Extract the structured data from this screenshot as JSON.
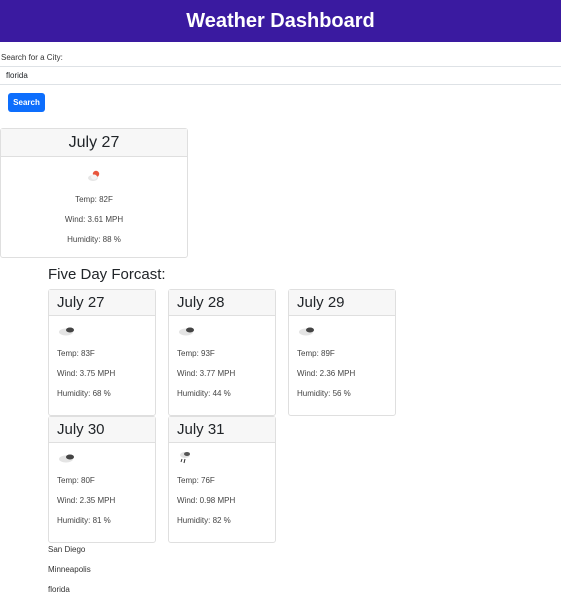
{
  "header": {
    "title": "Weather Dashboard"
  },
  "search": {
    "label": "Search for a City:",
    "value": "florida",
    "button_label": "Search"
  },
  "current": {
    "date": "July 27",
    "icon": "partly-cloudy-day-icon",
    "temp": "Temp: 82F",
    "wind": "Wind: 3.61 MPH",
    "humidity": "Humidity: 88 %"
  },
  "forecast": {
    "title": "Five Day Forcast:",
    "days": [
      {
        "date": "July 27",
        "icon": "overcast-clouds-icon",
        "temp": "Temp: 83F",
        "wind": "Wind: 3.75 MPH",
        "humidity": "Humidity: 68 %"
      },
      {
        "date": "July 28",
        "icon": "overcast-clouds-icon",
        "temp": "Temp: 93F",
        "wind": "Wind: 3.77 MPH",
        "humidity": "Humidity: 44 %"
      },
      {
        "date": "July 29",
        "icon": "overcast-clouds-icon",
        "temp": "Temp: 89F",
        "wind": "Wind: 2.36 MPH",
        "humidity": "Humidity: 56 %"
      },
      {
        "date": "July 30",
        "icon": "overcast-clouds-icon",
        "temp": "Temp: 80F",
        "wind": "Wind: 2.35 MPH",
        "humidity": "Humidity: 81 %"
      },
      {
        "date": "July 31",
        "icon": "rain-icon",
        "temp": "Temp: 76F",
        "wind": "Wind: 0.98 MPH",
        "humidity": "Humidity: 82 %"
      }
    ]
  },
  "history": [
    "San Diego",
    "Minneapolis",
    "florida"
  ]
}
